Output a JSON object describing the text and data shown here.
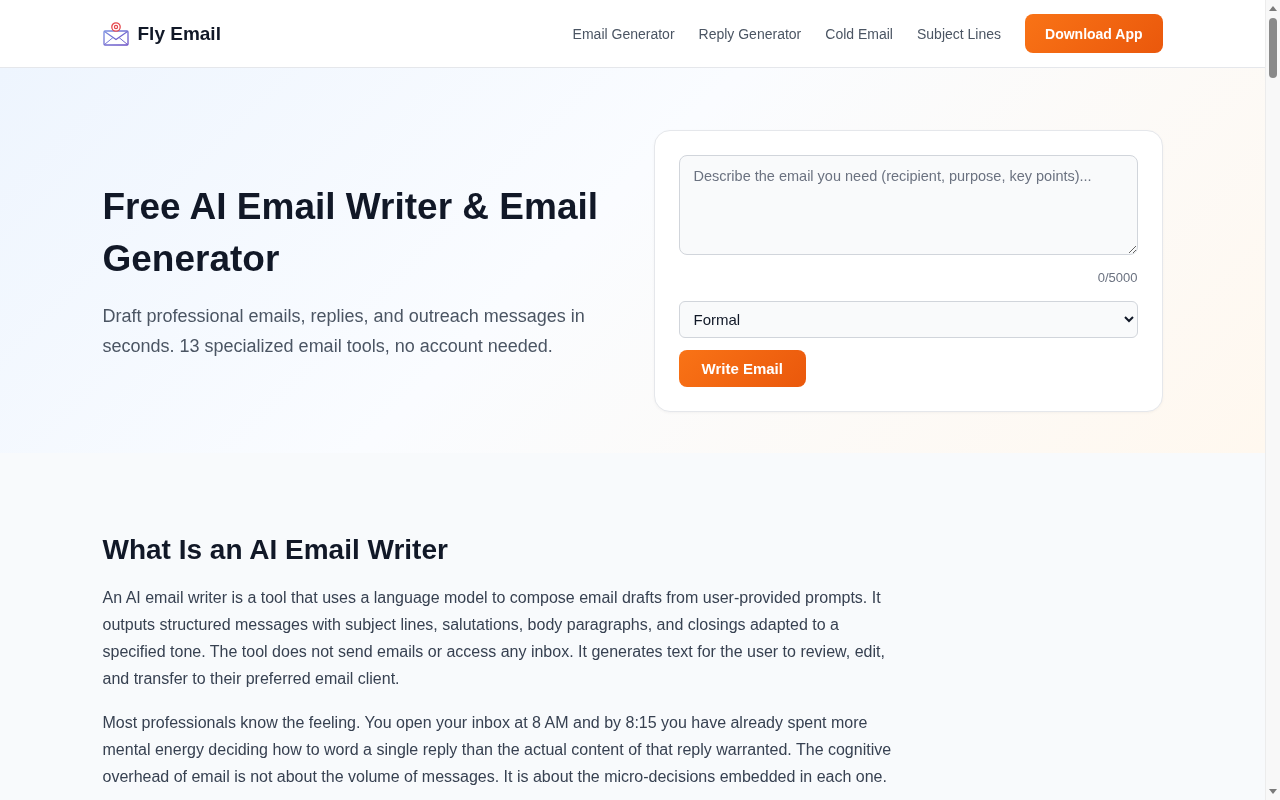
{
  "header": {
    "logo": {
      "text": "Fly Email"
    },
    "nav": [
      {
        "label": "Email Generator"
      },
      {
        "label": "Reply Generator"
      },
      {
        "label": "Cold Email"
      },
      {
        "label": "Subject Lines"
      }
    ],
    "cta": "Download App"
  },
  "hero": {
    "title": "Free AI Email Writer & Email Generator",
    "subtitle": "Draft professional emails, replies, and outreach messages in seconds. 13 specialized email tools, no account needed.",
    "form": {
      "prompt": {
        "placeholder": "Describe the email you need (recipient, purpose, key points)..."
      },
      "counter": "0/5000",
      "tone": {
        "value": "Formal"
      },
      "submit": "Write Email"
    }
  },
  "article": {
    "heading": "What Is an AI Email Writer",
    "paragraphs": [
      "An AI email writer is a tool that uses a language model to compose email drafts from user-provided prompts. It outputs structured messages with subject lines, salutations, body paragraphs, and closings adapted to a specified tone. The tool does not send emails or access any inbox. It generates text for the user to review, edit, and transfer to their preferred email client.",
      "Most professionals know the feeling. You open your inbox at 8 AM and by 8:15 you have already spent more mental energy deciding how to word a single reply than the actual content of that reply warranted. The cognitive overhead of email is not about the volume of messages. It is about the micro-decisions embedded in each one."
    ]
  }
}
